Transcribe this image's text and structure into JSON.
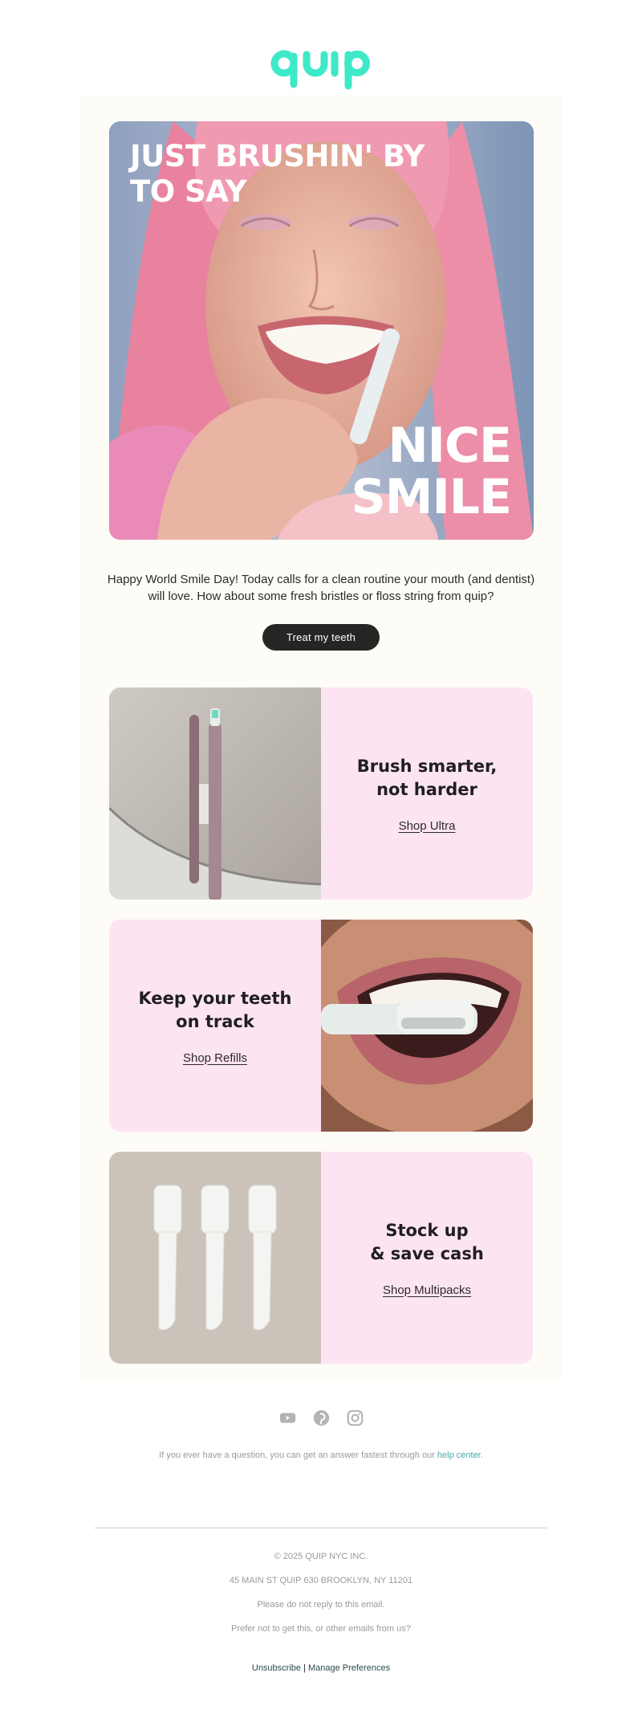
{
  "brand": {
    "logo_text": "quip",
    "accent_color": "#3de9c8"
  },
  "hero": {
    "headline_line1": "JUST BRUSHIN' BY",
    "headline_line2": "TO SAY",
    "tagline_line1": "NICE",
    "tagline_line2": "SMILE"
  },
  "intro": {
    "text": "Happy World Smile Day! Today calls for a clean routine your mouth (and dentist) will love. How about some fresh bristles or floss string from quip?",
    "cta_label": "Treat my teeth"
  },
  "tiles": [
    {
      "title_line1": "Brush smarter,",
      "title_line2": "not harder",
      "link": "Shop Ultra"
    },
    {
      "title_line1": "Keep your teeth",
      "title_line2": "on track",
      "link": "Shop Refills"
    },
    {
      "title_line1": "Stock up",
      "title_line2": "& save cash",
      "link": "Shop Multipacks"
    }
  ],
  "socials": [
    "youtube-icon",
    "pinterest-icon",
    "instagram-icon"
  ],
  "help": {
    "text": "If you ever have a question, you can get an answer fastest through our",
    "link": "help center",
    "suffix": "."
  },
  "footer": {
    "copyright": "© 2025 QUIP NYC INC.",
    "address": "45 MAIN ST QUIP 630 BROOKLYN, NY 11201",
    "noreply": "Please do not reply to this email.",
    "prefer": "Prefer not to get this, or other emails from us?",
    "unsubscribe": "Unsubscribe",
    "separator": "|",
    "manage": "Manage Preferences"
  }
}
